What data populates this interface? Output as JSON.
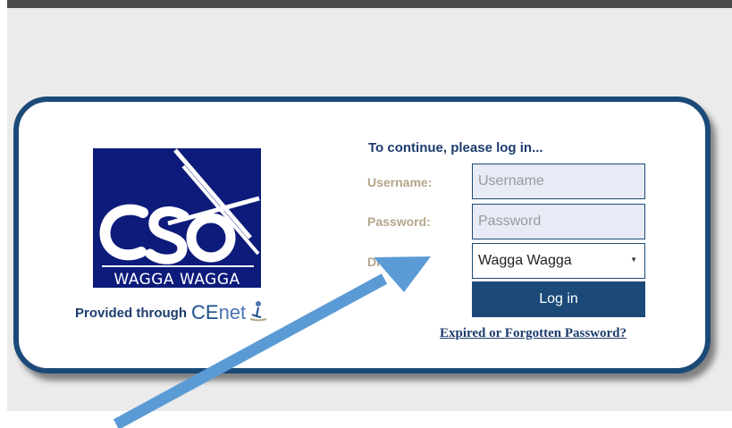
{
  "logo": {
    "text": "WAGGA WAGGA",
    "monogram": "cso",
    "background": "#0d1b7a"
  },
  "provided": {
    "text": "Provided through",
    "brand_ce": "CE",
    "brand_net": "net",
    "icon": "cenet-figure-icon"
  },
  "form": {
    "title": "To continue, please log in...",
    "username_label": "Username:",
    "username_placeholder": "Username",
    "password_label": "Password:",
    "password_placeholder": "Password",
    "diocese_label": "Dio",
    "diocese_value": "Wagga Wagga",
    "dropdown_icon": "caret-down-icon",
    "login_label": "Log in",
    "forgot_link": "Expired or Forgotten Password?"
  },
  "colors": {
    "card_border": "#1c4a78",
    "button_bg": "#1c4a78",
    "label_color": "#b3a68a",
    "annotation_arrow": "#5b9bd5"
  },
  "annotation": {
    "icon": "blue-arrow-annotation"
  }
}
